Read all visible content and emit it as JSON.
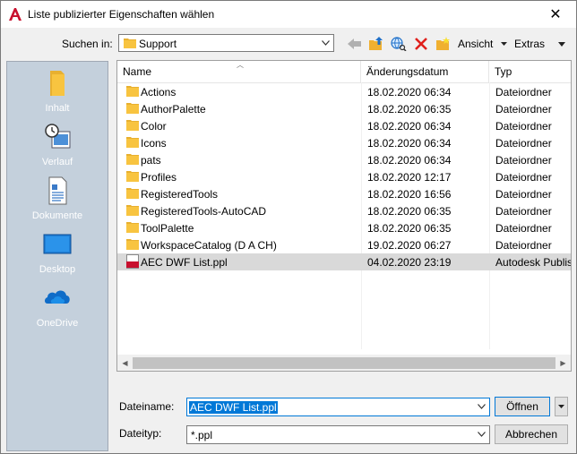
{
  "window": {
    "title": "Liste publizierter Eigenschaften wählen",
    "close_glyph": "✕"
  },
  "toolbar": {
    "lookin_label": "Suchen in:",
    "lookin_value": "Support",
    "view_label": "Ansicht",
    "tools_label": "Extras"
  },
  "places": [
    {
      "label": "Inhalt",
      "icon": "folder-icon"
    },
    {
      "label": "Verlauf",
      "icon": "history-icon"
    },
    {
      "label": "Dokumente",
      "icon": "documents-icon"
    },
    {
      "label": "Desktop",
      "icon": "desktop-icon"
    },
    {
      "label": "OneDrive",
      "icon": "onedrive-icon"
    }
  ],
  "list": {
    "columns": [
      "Name",
      "Änderungsdatum",
      "Typ"
    ],
    "rows": [
      {
        "name": "Actions",
        "date": "18.02.2020 06:34",
        "type": "Dateiordner",
        "kind": "folder"
      },
      {
        "name": "AuthorPalette",
        "date": "18.02.2020 06:35",
        "type": "Dateiordner",
        "kind": "folder"
      },
      {
        "name": "Color",
        "date": "18.02.2020 06:34",
        "type": "Dateiordner",
        "kind": "folder"
      },
      {
        "name": "Icons",
        "date": "18.02.2020 06:34",
        "type": "Dateiordner",
        "kind": "folder"
      },
      {
        "name": "pats",
        "date": "18.02.2020 06:34",
        "type": "Dateiordner",
        "kind": "folder"
      },
      {
        "name": "Profiles",
        "date": "18.02.2020 12:17",
        "type": "Dateiordner",
        "kind": "folder"
      },
      {
        "name": "RegisteredTools",
        "date": "18.02.2020 16:56",
        "type": "Dateiordner",
        "kind": "folder"
      },
      {
        "name": "RegisteredTools-AutoCAD",
        "date": "18.02.2020 06:35",
        "type": "Dateiordner",
        "kind": "folder"
      },
      {
        "name": "ToolPalette",
        "date": "18.02.2020 06:35",
        "type": "Dateiordner",
        "kind": "folder"
      },
      {
        "name": "WorkspaceCatalog (D A CH)",
        "date": "19.02.2020 06:27",
        "type": "Dateiordner",
        "kind": "folder"
      },
      {
        "name": "AEC DWF List.ppl",
        "date": "04.02.2020 23:19",
        "type": "Autodesk Publis",
        "kind": "ppl",
        "selected": true
      }
    ]
  },
  "bottom": {
    "filename_label": "Dateiname:",
    "filename_value": "AEC DWF List.ppl",
    "filetype_label": "Dateityp:",
    "filetype_value": "*.ppl",
    "open_label": "Öffnen",
    "cancel_label": "Abbrechen"
  },
  "colors": {
    "accent": "#0078d7",
    "folder": "#f8c440",
    "selected_row": "#d9d9d9",
    "places_bg": "#c4d0dc",
    "close_red": "#e81123",
    "autocad_red": "#c8102e"
  }
}
